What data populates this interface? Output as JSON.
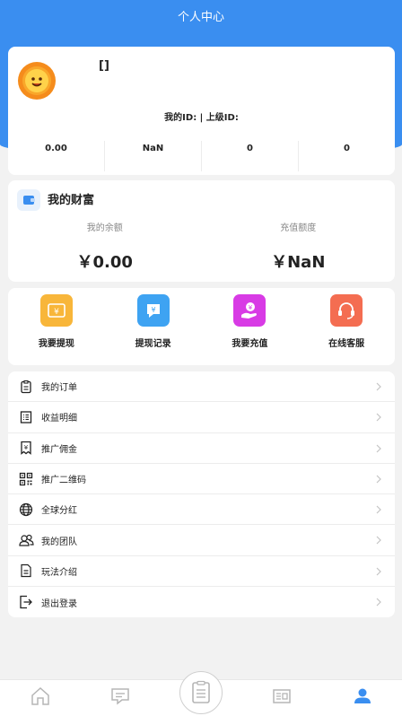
{
  "header": {
    "title": "个人中心"
  },
  "profile": {
    "username": "[]",
    "ids_text": "我的ID: | 上级ID:",
    "stats": [
      "0.00",
      "NaN",
      "0",
      "0"
    ]
  },
  "wealth": {
    "title": "我的财富",
    "balance_label": "我的余额",
    "balance_value": "￥0.00",
    "recharge_label": "充值额度",
    "recharge_value": "￥NaN"
  },
  "actions": [
    {
      "label": "我要提现",
      "icon": "withdraw-icon",
      "color": "#f8b63a"
    },
    {
      "label": "提现记录",
      "icon": "withdraw-record-icon",
      "color": "#3ea3f2"
    },
    {
      "label": "我要充值",
      "icon": "recharge-icon",
      "color": "#d83be5"
    },
    {
      "label": "在线客服",
      "icon": "customer-service-icon",
      "color": "#f46d51"
    }
  ],
  "menu": [
    {
      "label": "我的订单",
      "icon": "order-clipboard-icon"
    },
    {
      "label": "收益明细",
      "icon": "list-icon"
    },
    {
      "label": "推广佣金",
      "icon": "commission-receipt-icon"
    },
    {
      "label": "推广二维码",
      "icon": "qr-code-icon"
    },
    {
      "label": "全球分红",
      "icon": "globe-icon"
    },
    {
      "label": "我的团队",
      "icon": "team-icon"
    },
    {
      "label": "玩法介绍",
      "icon": "intro-document-icon"
    },
    {
      "label": "退出登录",
      "icon": "logout-icon"
    }
  ],
  "tabbar": {
    "icons": [
      "home-icon",
      "message-icon",
      "center-document-icon",
      "card-icon",
      "profile-icon"
    ],
    "active_color": "#3a8ef0",
    "inactive_color": "#b5b5b5"
  }
}
